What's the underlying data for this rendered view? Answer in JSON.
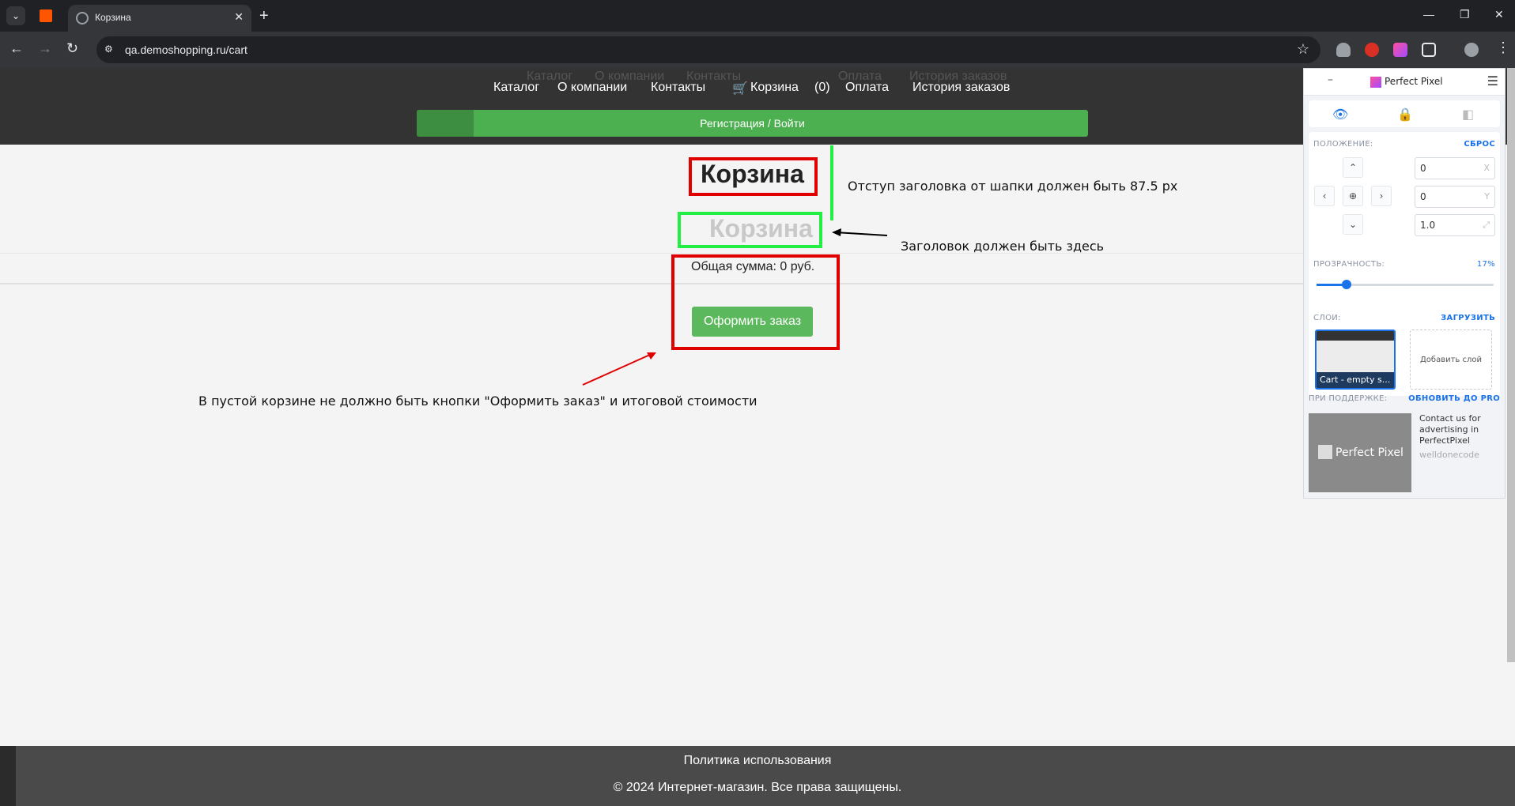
{
  "browser": {
    "tab_title": "Корзина",
    "new_tab": "+",
    "url": "qa.demoshopping.ru/cart",
    "win_min": "—",
    "win_restore": "❐",
    "win_close": "✕"
  },
  "site": {
    "nav": {
      "catalog": "Каталог",
      "about": "О компании",
      "contacts": "Контакты",
      "cart": "Корзина",
      "cart_count": "(0)",
      "payment": "Оплата",
      "history": "История заказов"
    },
    "ghost_nav": [
      "Каталог",
      "О компании",
      "Контакты",
      "Корзина",
      "Оплата",
      "История заказов"
    ],
    "register_label": "Регистрация / Войти",
    "page_title": "Корзина",
    "ghost_title": "Корзина",
    "total": "Общая сумма: 0 руб.",
    "checkout_label": "Оформить заказ",
    "footer_link": "Политика использования",
    "footer_copy": "© 2024 Интернет-магазин. Все права защищены."
  },
  "annotations": {
    "offset_note": "Отступ заголовка от шапки должен быть 87.5 px",
    "title_note": "Заголовок должен быть здесь",
    "empty_cart_note": "В пустой корзине не должно быть кнопки \"Оформить заказ\" и итоговой стоимости",
    "colors": {
      "red": "#e00000",
      "green": "#22ee44",
      "arrow_red": "#e00000",
      "arrow_black": "#000000"
    }
  },
  "perfect_pixel": {
    "name": "Perfect Pixel",
    "position_label": "ПОЛОЖЕНИЕ:",
    "reset_label": "СБРОС",
    "x_value": "0",
    "x_axis": "X",
    "y_value": "0",
    "y_axis": "Y",
    "scale_value": "1.0",
    "opacity_label": "ПРОЗРАЧНОСТЬ:",
    "opacity_value": "17%",
    "opacity_fraction": 0.17,
    "layers_label": "СЛОИ:",
    "upload_label": "ЗАГРУЗИТЬ",
    "layer_name": "Cart - empty s...",
    "add_layer": "Добавить слой",
    "support_label": "ПРИ ПОДДЕРЖКЕ:",
    "upgrade_label": "ОБНОВИТЬ ДО PRO",
    "ad_brand": "Perfect Pixel",
    "ad_text": "Contact us for advertising in PerfectPixel",
    "ad_sub": "welldonecode",
    "accent": "#1a73e8"
  }
}
